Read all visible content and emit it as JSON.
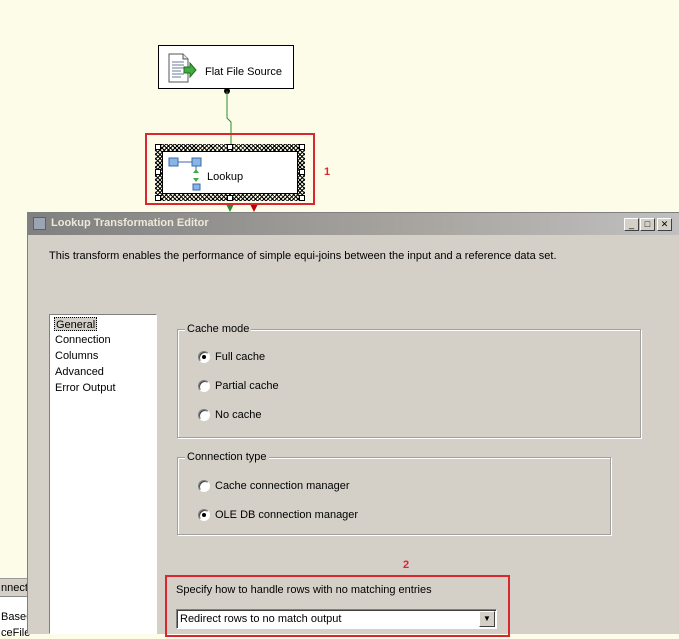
{
  "designer": {
    "flat_file_source_label": "Flat File Source",
    "lookup_label": "Lookup",
    "annotation_1": "1",
    "annotation_2": "2",
    "bottom_strip": {
      "header": "nnectio",
      "rows": [
        "BaseC",
        "ceFile"
      ]
    }
  },
  "dialog": {
    "title": "Lookup Transformation Editor",
    "title_buttons": {
      "minimize": "_",
      "maximize": "□",
      "close": "✕"
    },
    "description": "This transform enables the performance of simple equi-joins between the input and a reference data set.",
    "nav_items": [
      "General",
      "Connection",
      "Columns",
      "Advanced",
      "Error Output"
    ],
    "selected_nav": "General",
    "cache_mode": {
      "legend": "Cache mode",
      "options": [
        "Full cache",
        "Partial cache",
        "No cache"
      ],
      "selected": "Full cache"
    },
    "connection_type": {
      "legend": "Connection type",
      "options": [
        "Cache connection manager",
        "OLE DB connection manager"
      ],
      "selected": "OLE DB connection manager"
    },
    "no_match": {
      "label": "Specify how to handle rows with no matching entries",
      "selected_value": "Redirect rows to no match output"
    }
  },
  "colors": {
    "annotation_red": "#d9262f",
    "dialog_bg": "#d4d0c8",
    "designer_bg": "#fcfce8",
    "path_green": "#2e8b2e"
  }
}
